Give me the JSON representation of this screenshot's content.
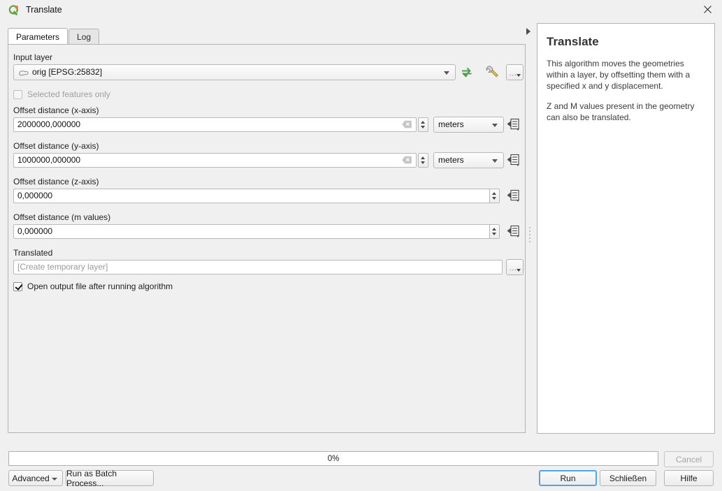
{
  "window": {
    "title": "Translate",
    "app_icon": "qgis-logo-icon",
    "close_label": "✕"
  },
  "tabs": [
    {
      "label": "Parameters",
      "active": true
    },
    {
      "label": "Log",
      "active": false
    }
  ],
  "parameters": {
    "input_layer": {
      "label": "Input layer",
      "value": "orig [EPSG:25832]",
      "layer_icon": "polygon-layer-icon",
      "iterate_icon": "iterate-over-features-icon",
      "advanced_icon": "wrench-icon",
      "browse_label": "..."
    },
    "selected_features_only": {
      "label": "Selected features only",
      "checked": false,
      "enabled": false
    },
    "offset_x": {
      "label": "Offset distance (x-axis)",
      "value": "2000000,000000",
      "unit": "meters",
      "clear_icon": "clear-value-icon",
      "override_icon": "data-defined-override-icon"
    },
    "offset_y": {
      "label": "Offset distance (y-axis)",
      "value": "1000000,000000",
      "unit": "meters",
      "clear_icon": "clear-value-icon",
      "override_icon": "data-defined-override-icon"
    },
    "offset_z": {
      "label": "Offset distance (z-axis)",
      "value": "0,000000",
      "override_icon": "data-defined-override-icon"
    },
    "offset_m": {
      "label": "Offset distance (m values)",
      "value": "0,000000",
      "override_icon": "data-defined-override-icon"
    },
    "output": {
      "label": "Translated",
      "placeholder": "[Create temporary layer]",
      "value": "",
      "browse_label": "..."
    },
    "open_output": {
      "label": "Open output file after running algorithm",
      "checked": true
    }
  },
  "help": {
    "title": "Translate",
    "paragraph1": "This algorithm moves the geometries within a layer, by offsetting them with a specified x and y displacement.",
    "paragraph2": "Z and M values present in the geometry can also be translated."
  },
  "footer": {
    "progress_text": "0%",
    "progress_value": 0,
    "advanced_label": "Advanced",
    "batch_label": "Run as Batch Process...",
    "cancel_label": "Cancel",
    "cancel_enabled": false,
    "run_label": "Run",
    "close_label": "Schließen",
    "help_label": "Hilfe"
  },
  "colors": {
    "window_bg": "#f0f0f0",
    "panel_border": "#b4b4b4",
    "field_bg": "#ffffff",
    "accent_focus": "#54a3e8",
    "qgis_green": "#5f9f3f",
    "qgis_orange": "#e07b2c",
    "disabled_text": "#a0a0a0"
  }
}
